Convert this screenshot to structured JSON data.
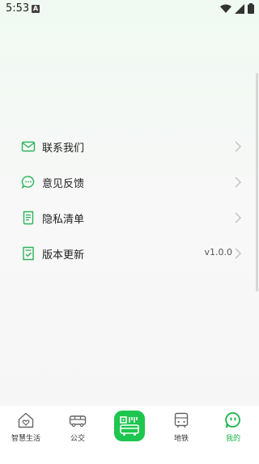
{
  "status_bar": {
    "time": "5:53",
    "a_label": "A"
  },
  "menu": {
    "items": [
      {
        "label": "联系我们",
        "icon": "mail-icon",
        "value": ""
      },
      {
        "label": "意见反馈",
        "icon": "chat-bubble-icon",
        "value": ""
      },
      {
        "label": "隐私清单",
        "icon": "document-list-icon",
        "value": ""
      },
      {
        "label": "版本更新",
        "icon": "version-check-icon",
        "value": "v1.0.0"
      }
    ]
  },
  "tab_bar": {
    "tabs": [
      {
        "label": "智慧生活",
        "icon": "home-heart-icon"
      },
      {
        "label": "公交",
        "icon": "bus-icon"
      },
      {
        "label": "",
        "icon": "scan-qr-bus-icon"
      },
      {
        "label": "地铁",
        "icon": "metro-icon"
      },
      {
        "label": "我的",
        "icon": "profile-face-icon",
        "active": true
      }
    ]
  },
  "colors": {
    "accent": "#1dc64e",
    "active_text": "#1bb44b",
    "icon_green": "#2ab35a"
  }
}
